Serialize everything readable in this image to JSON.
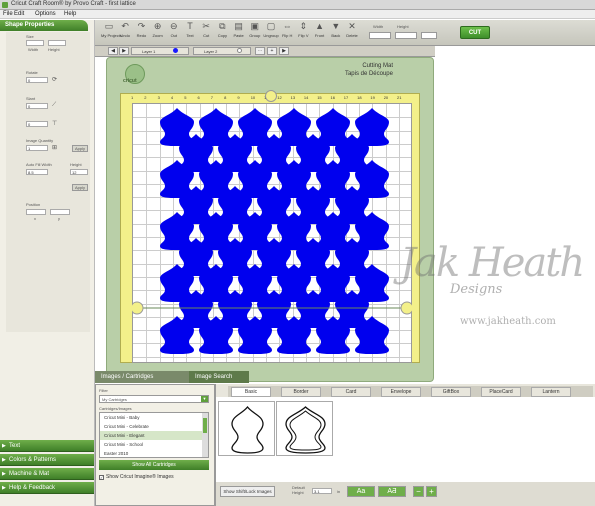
{
  "window": {
    "title": "Cricut Craft Room® by Provo Craft - first lattice"
  },
  "menu": {
    "items": [
      "File",
      "Edit",
      "Options",
      "Help"
    ]
  },
  "toolbar": {
    "tools": [
      {
        "label": "My Projects",
        "icon": "folder-icon"
      },
      {
        "label": "Undo",
        "icon": "undo-icon"
      },
      {
        "label": "Redo",
        "icon": "redo-icon"
      },
      {
        "label": "Zoom",
        "icon": "zoom-in-icon"
      },
      {
        "label": "Out",
        "icon": "zoom-out-icon"
      },
      {
        "label": "Text",
        "icon": "text-icon"
      },
      {
        "label": "Cut",
        "icon": "scissors-icon"
      },
      {
        "label": "Copy",
        "icon": "copy-icon"
      },
      {
        "label": "Paste",
        "icon": "paste-icon"
      },
      {
        "label": "Group",
        "icon": "group-icon"
      },
      {
        "label": "Ungroup",
        "icon": "ungroup-icon"
      },
      {
        "label": "Flip H",
        "icon": "flip-h-icon"
      },
      {
        "label": "Flip V",
        "icon": "flip-v-icon"
      },
      {
        "label": "Front",
        "icon": "front-icon"
      },
      {
        "label": "Back",
        "icon": "back-icon"
      },
      {
        "label": "Delete",
        "icon": "delete-icon"
      }
    ],
    "width_label": "Width",
    "height_label": "Height",
    "cut_label": "CUT"
  },
  "left_panel": {
    "header": "Shape Properties",
    "size_label": "Size",
    "width_label": "Width",
    "height_label": "Height",
    "rotate_label": "Rotate",
    "rotate_value": "0",
    "slant_label": "Slant",
    "slant_value": "0",
    "weld_value": "0",
    "image_quantity_label": "Image Quantity",
    "image_quantity_value": "1",
    "auto_fill_width_label": "Auto Fill Width",
    "auto_fill_width_value": "8.5",
    "height_fill_label": "Height",
    "height_fill_value": "12",
    "apply_label": "Apply",
    "position_label": "Position",
    "pos_x_label": "x",
    "pos_y_label": "y",
    "nav": [
      "Text",
      "Colors & Patterns",
      "Machine & Mat",
      "Help & Feedback"
    ]
  },
  "layers": {
    "layer1": "Layer 1",
    "layer2": "Layer 2",
    "layer1_color": "#1a1aff",
    "layer2_color": "#ffffff"
  },
  "mat": {
    "brand": "cricut",
    "title_en": "Cutting Mat",
    "title_fr": "Tapis de Découpe",
    "shape_color": "#0000ee",
    "ruler_numbers": [
      "1",
      "2",
      "3",
      "4",
      "5",
      "6",
      "7",
      "8",
      "9",
      "10",
      "11",
      "12",
      "13",
      "14",
      "15",
      "16",
      "17",
      "18",
      "19",
      "20",
      "21"
    ]
  },
  "bottom_tabs": {
    "tab1": "Images / Cartridges",
    "tab2": "Image Search"
  },
  "filter_panel": {
    "filter_label": "Filter",
    "filter_value": "My Cartridges",
    "list_label": "Cartridges/Images",
    "cartridges": [
      "Cricut Mini - Baby",
      "Cricut Mini - Celebrate",
      "Cricut Mini - Elegant",
      "Cricut Mini - School",
      "Easter 2010"
    ],
    "selected_index": 2,
    "show_all_label": "Show All Cartridges",
    "imagine_label": "Show Cricut Imagine® Images",
    "imagine_checked": "✓"
  },
  "image_panel": {
    "categories": [
      "Basic",
      "Border",
      "Card",
      "Envelope",
      "GiftBox",
      "PlaceCard",
      "Lantern"
    ],
    "active_category": "Basic",
    "shift_lock_label": "Show Shift/Lock Images",
    "default_height_label": "Default Height",
    "default_height_value": "3.1",
    "in_label": "in",
    "aa_label": "Aa",
    "aa_bold_label": "AƋ",
    "minus_label": "−",
    "plus_label": "+"
  },
  "watermark": {
    "line1": "Jak Heath",
    "line2": "Designs",
    "line3": "www.jakheath.com"
  }
}
